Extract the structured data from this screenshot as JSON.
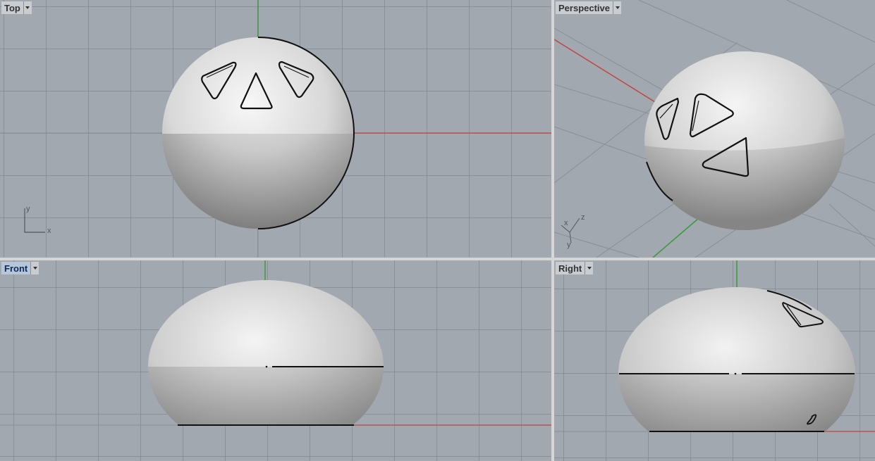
{
  "viewports": {
    "top": {
      "label": "Top",
      "active": false
    },
    "perspective": {
      "label": "Perspective",
      "active": false
    },
    "front": {
      "label": "Front",
      "active": true
    },
    "right": {
      "label": "Right",
      "active": false
    }
  },
  "axis_labels": {
    "x": "x",
    "y": "y",
    "z": "z"
  },
  "colors": {
    "viewport_bg": "#a2a8b0",
    "grid_line": "#7e848b",
    "x_axis": "#c0463f",
    "y_axis": "#3a9a3a",
    "active_label_bg": "#b7c6d8"
  },
  "icons": {
    "dropdown": "chevron-down-icon",
    "gizmo": "axis-gizmo-icon"
  }
}
